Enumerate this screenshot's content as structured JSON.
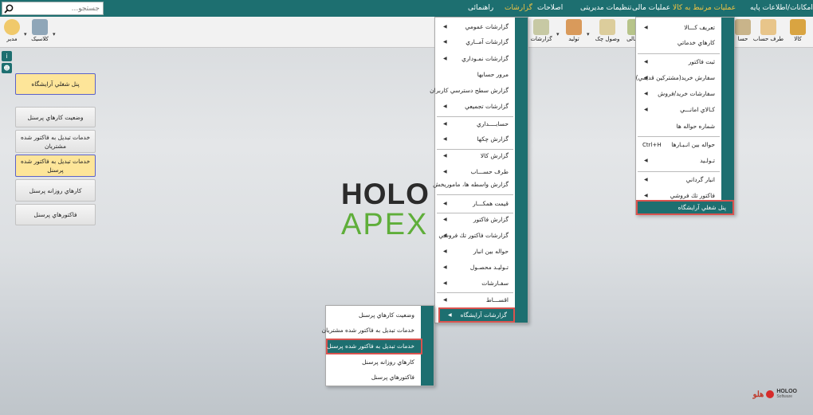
{
  "menubar": {
    "items": [
      {
        "label": "امکانات/اطلاعات پایه",
        "active": false
      },
      {
        "label": "عملیات مرتبط به کالا",
        "active": true
      },
      {
        "label": "عملیات مالی",
        "active": false
      },
      {
        "label": "تنظیمات مدیریتی",
        "active": false
      },
      {
        "label": "اصلاحات",
        "active": false
      },
      {
        "label": "گزارشات",
        "active": true
      },
      {
        "label": "راهنمائی",
        "active": false
      }
    ],
    "search_placeholder": "جستجو...",
    "accent": "#1d6f70",
    "active_color": "#f4c542"
  },
  "toolbar": {
    "buttons": [
      {
        "label": "کالا",
        "icon": "box-icon"
      },
      {
        "label": "طرف حساب",
        "icon": "person-icon"
      },
      {
        "label": "حسا",
        "icon": "ledger-icon"
      },
      {
        "label": "مالی",
        "icon": "money-icon"
      },
      {
        "label": "وصول چک",
        "icon": "check-icon"
      },
      {
        "label": "تولید",
        "icon": "factory-icon"
      },
      {
        "label": "گزارشات",
        "icon": "report-icon"
      },
      {
        "label": "کلاسیک",
        "icon": "classic-icon"
      },
      {
        "label": "مدیر",
        "icon": "manager-icon"
      }
    ]
  },
  "left_panel": {
    "buttons": [
      "پنل شغلي آرايشگاه",
      "وضعيت کارهاي پرسنل",
      "خدمات تبديل به فاکتور شده مشتريان",
      "خدمات تبديل به فاکتور شده پرسنل",
      "کارهاي روزانه پرسنل",
      "فاکتورهاي پرسنل"
    ]
  },
  "logo": {
    "line1": "HOLO",
    "line2": "APEX"
  },
  "kala_menu": {
    "items": [
      {
        "label": "تعريف کـــالا",
        "arrow": true
      },
      {
        "label": "کارهاي خدماتي",
        "arrow": false
      },
      {
        "label": "ثبت فاکتور",
        "arrow": true
      },
      {
        "label": "سفارش خريد(مشترکين قديمي)",
        "arrow": true
      },
      {
        "label": "سفارشات خريد/فروش",
        "arrow": true
      },
      {
        "label": "کـالاي امانـــي",
        "arrow": true
      },
      {
        "label": "شماره حواله ها",
        "arrow": false
      },
      {
        "label": "حواله بين انـبـارها",
        "arrow": false,
        "shortcut": "Ctrl+H"
      },
      {
        "label": "تـولـيد",
        "arrow": true
      },
      {
        "label": "انبار گرداني",
        "arrow": true
      },
      {
        "label": "فاکتور تك فروشي",
        "arrow": true
      },
      {
        "label": "پنل شغلي آرايشگاه",
        "arrow": false,
        "highlight": true
      }
    ]
  },
  "reports_menu": {
    "items": [
      {
        "label": "گزارشات عمومي",
        "arrow": true
      },
      {
        "label": "گزارشات آمــاري",
        "arrow": true
      },
      {
        "label": "گزارشات نمـوداري",
        "arrow": true
      },
      {
        "label": "مرور حسابها",
        "arrow": false
      },
      {
        "label": "گزارش سطح دسترسي کاربران",
        "arrow": false
      },
      {
        "label": "گزارشات تجميعي",
        "arrow": true
      },
      {
        "label": "حسابــــداري",
        "arrow": true
      },
      {
        "label": "گزارش چکها",
        "arrow": true
      },
      {
        "label": "گزارش کالا",
        "arrow": true
      },
      {
        "label": "طرف حســـاب",
        "arrow": true
      },
      {
        "label": "گزارش واسطه ها، ماموريخش",
        "arrow": false
      },
      {
        "label": "قيمت همکـــار",
        "arrow": true
      },
      {
        "label": "گزارش فاکتور",
        "arrow": true
      },
      {
        "label": "گزارشات فاکتور تك فروشي",
        "arrow": true
      },
      {
        "label": "حواله بين انبار",
        "arrow": true
      },
      {
        "label": "تـوليـد محصـول",
        "arrow": true
      },
      {
        "label": "سفـارشات",
        "arrow": true
      },
      {
        "label": "اقســـاط",
        "arrow": true
      },
      {
        "label": "گزارشات آرايشگاه",
        "arrow": true,
        "highlight": true
      }
    ]
  },
  "salon_submenu": {
    "items": [
      {
        "label": "وضعيت کارهاي پرسنل",
        "highlight": false
      },
      {
        "label": "خدمات تبديل به فاکتور شده مشتريان",
        "highlight": false
      },
      {
        "label": "خدمات تبديل به فاکتور شده پرسنل",
        "highlight": true
      },
      {
        "label": "کارهاي روزانه پرسنل",
        "highlight": false
      },
      {
        "label": "فاکتورهاي پرسنل",
        "highlight": false
      }
    ]
  },
  "brand": {
    "name": "HOLOO",
    "sub": "Software",
    "fa": "هلو"
  }
}
